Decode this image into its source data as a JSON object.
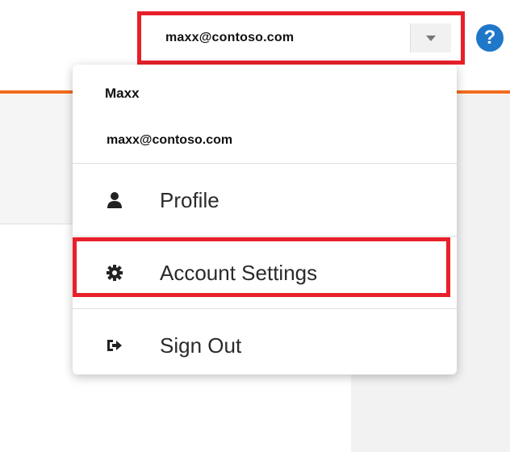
{
  "header": {
    "account_email": "maxx@contoso.com"
  },
  "user_menu": {
    "name": "Maxx",
    "email": "maxx@contoso.com",
    "items": [
      {
        "label": "Profile",
        "icon": "user-icon"
      },
      {
        "label": "Account Settings",
        "icon": "gear-icon"
      },
      {
        "label": "Sign Out",
        "icon": "sign-out-icon"
      }
    ]
  },
  "colors": {
    "highlight": "#e8202a",
    "accent": "#f26b1d",
    "help": "#1f77c9"
  }
}
